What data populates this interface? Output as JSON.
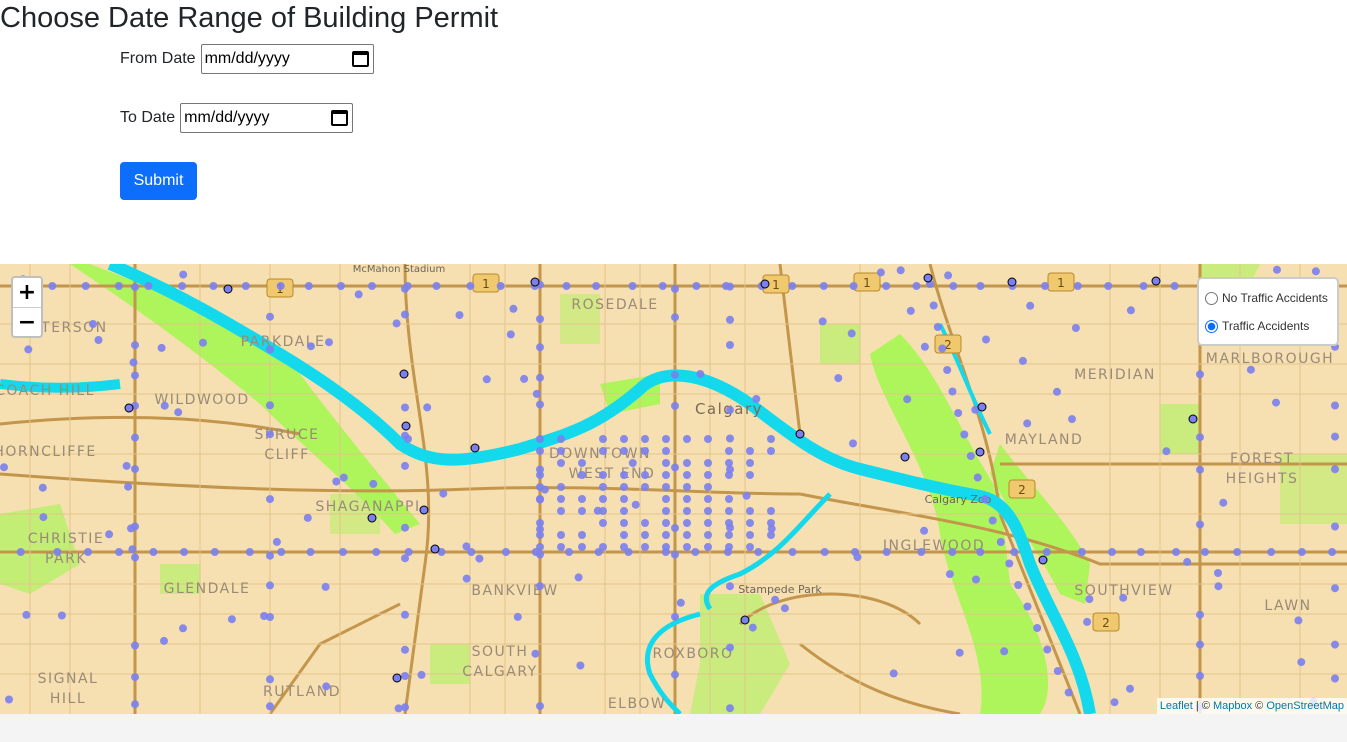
{
  "page": {
    "title": "Choose Date Range of Building Permit"
  },
  "form": {
    "from_label": "From Date",
    "from_value": "mm/dd/yyyy",
    "to_label": "To Date",
    "to_value": "mm/dd/yyyy",
    "submit_label": "Submit"
  },
  "map": {
    "zoom_in": "+",
    "zoom_out": "−",
    "layers": [
      {
        "label": "No Traffic Accidents",
        "selected": false
      },
      {
        "label": "Traffic Accidents",
        "selected": true
      }
    ],
    "attribution": {
      "leaflet": "Leaflet",
      "sep1": " | © ",
      "mapbox": "Mapbox",
      "sep2": " © ",
      "osm": "OpenStreetMap"
    },
    "place_labels": [
      "Calgary",
      "ROSEDALE",
      "PARKDALE",
      "WILDWOOD",
      "SPRUCE",
      "CLIFF",
      "SHAGANAPPI",
      "CHRISTIE",
      "PARK",
      "GLENDALE",
      "BANKVIEW",
      "SOUTH",
      "CALGARY",
      "ROXBORO",
      "ELBOW",
      "RUTLAND",
      "SIGNAL",
      "HILL",
      "MERIDIAN",
      "MAYLAND",
      "FOREST",
      "HEIGHTS",
      "INGLEWOOD",
      "SOUTHVIEW",
      "LAWN",
      "MARLBOROUGH",
      "Calgary Zoo",
      "Stampede Park",
      "DOWNTOWN",
      "WEST END",
      "PATTERSON",
      "COACH HILL",
      "THORNCLIFFE",
      "McMahon Stadium"
    ],
    "highway_shields": [
      "1",
      "1",
      "1",
      "1",
      "1",
      "2",
      "2",
      "2"
    ],
    "colors": {
      "land": "#f6dfb1",
      "park": "#aef45b",
      "water": "#14d8ec",
      "road": "#c3964b",
      "marker": "#7b7ff0"
    }
  }
}
